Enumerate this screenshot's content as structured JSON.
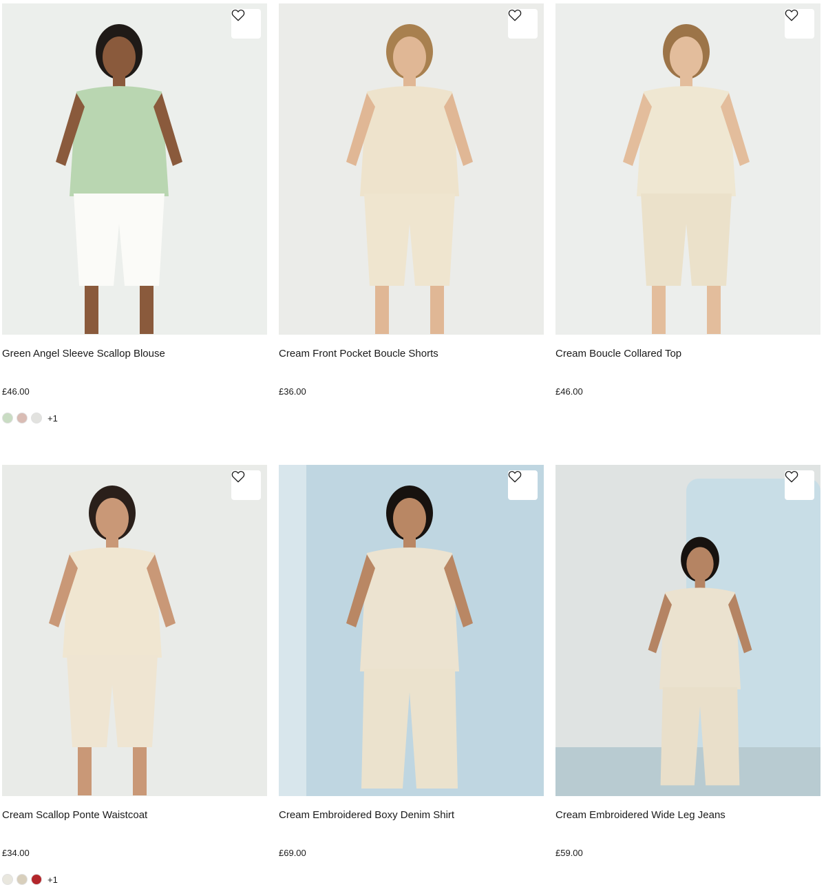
{
  "products": [
    {
      "name": "Green Angel Sleeve Scallop Blouse",
      "price": "£46.00",
      "swatches": [
        "#c9dcc3",
        "#d9bcb4",
        "#e2e2df"
      ],
      "more_colours": "+1",
      "photo": {
        "bg": "#ecefec",
        "top": "#b9d6b1",
        "bottom": "#fbfbf8",
        "skin": "#8a5a3c",
        "hair": "#1f1a17"
      }
    },
    {
      "name": "Cream Front Pocket Boucle Shorts",
      "price": "£36.00",
      "photo": {
        "bg": "#ebece9",
        "top": "#eee3cc",
        "bottom": "#efe5cf",
        "skin": "#e0b795",
        "hair": "#a8804f"
      }
    },
    {
      "name": "Cream Boucle Collared Top",
      "price": "£46.00",
      "photo": {
        "bg": "#eceeec",
        "top": "#efe7d2",
        "bottom": "#ebe1ca",
        "skin": "#e3bd9c",
        "hair": "#9c7448"
      }
    },
    {
      "name": "Cream Scallop Ponte Waistcoat",
      "price": "£34.00",
      "swatches": [
        "#e9e7de",
        "#d8cfbc",
        "#b3262b"
      ],
      "more_colours": "+1",
      "photo": {
        "bg": "#e9ebe8",
        "top": "#f0e6d1",
        "bottom": "#efe5d2",
        "skin": "#c99877",
        "hair": "#2a1f1a"
      }
    },
    {
      "name": "Cream Embroidered Boxy Denim Shirt",
      "price": "£69.00",
      "photo": {
        "bg": "#c9dce5",
        "top": "#ece3d0",
        "bottom": "#ebe2cd",
        "skin": "#b98764",
        "hair": "#17120f"
      }
    },
    {
      "name": "Cream Embroidered Wide Leg Jeans",
      "price": "£59.00",
      "photo": {
        "bg": "#dfe3e2",
        "top": "#ebe2cf",
        "bottom": "#e9dfca",
        "skin": "#b58463",
        "hair": "#17120f"
      }
    }
  ],
  "icons": {
    "wishlist": "heart-outline-icon"
  }
}
